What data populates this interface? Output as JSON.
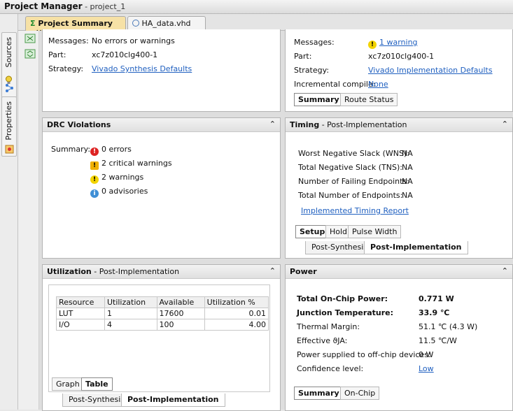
{
  "window": {
    "app": "Project Manager",
    "project": "project_1"
  },
  "sidebar": {
    "tabs": [
      {
        "label": "Sources",
        "icon": "hierarchy-icon"
      },
      {
        "label": "Properties",
        "icon": "properties-icon"
      }
    ]
  },
  "tabs": [
    {
      "label": "Project Summary",
      "close": "✕",
      "icon": "sigma-icon"
    },
    {
      "label": "HA_data.vhd",
      "close": "✕",
      "icon": "vhdl-file-icon"
    }
  ],
  "synthesis": {
    "messages_label": "Messages:",
    "messages_value": "No errors or warnings",
    "part_label": "Part:",
    "part_value": "xc7z010clg400-1",
    "strategy_label": "Strategy:",
    "strategy_value": "Vivado Synthesis Defaults"
  },
  "implementation": {
    "messages_label": "Messages:",
    "messages_value": "1 warning",
    "part_label": "Part:",
    "part_value": "xc7z010clg400-1",
    "strategy_label": "Strategy:",
    "strategy_value": "Vivado Implementation Defaults",
    "incremental_label": "Incremental compile:",
    "incremental_value": "None",
    "tabs": [
      "Summary",
      "Route Status"
    ]
  },
  "drc": {
    "title": "DRC Violations",
    "summary_label": "Summary:",
    "items": [
      "0 errors",
      "2 critical warnings",
      "2 warnings",
      "0 advisories"
    ]
  },
  "timing": {
    "title": "Timing",
    "subtitle": "- Post-Implementation",
    "rows": [
      {
        "label": "Worst Negative Slack (WNS):",
        "value": "NA"
      },
      {
        "label": "Total Negative Slack (TNS):",
        "value": "NA"
      },
      {
        "label": "Number of Failing Endpoints:",
        "value": "NA"
      },
      {
        "label": "Total Number of Endpoints:",
        "value": "NA"
      }
    ],
    "report_link": "Implemented Timing Report",
    "tabs": [
      "Setup",
      "Hold",
      "Pulse Width"
    ],
    "subtabs": [
      "Post-Synthesis",
      "Post-Implementation"
    ]
  },
  "utilization": {
    "title": "Utilization",
    "subtitle": "- Post-Implementation",
    "columns": [
      "Resource",
      "Utilization",
      "Available",
      "Utilization %"
    ],
    "rows": [
      [
        "LUT",
        "1",
        "17600",
        "0.01"
      ],
      [
        "I/O",
        "4",
        "100",
        "4.00"
      ]
    ],
    "tabs": [
      "Graph",
      "Table"
    ],
    "subtabs": [
      "Post-Synthesis",
      "Post-Implementation"
    ]
  },
  "power": {
    "title": "Power",
    "total_label": "Total On-Chip Power:",
    "total_value": "0.771 W",
    "junction_label": "Junction Temperature:",
    "junction_value": "33.9 ℃",
    "margin_label": "Thermal Margin:",
    "margin_value": "51.1 ℃ (4.3 W)",
    "theta_label": "Effective ϑJA:",
    "theta_value": "11.5 ℃/W",
    "offchip_label": "Power supplied to off-chip devices:",
    "offchip_value": "0 W",
    "confidence_label": "Confidence level:",
    "confidence_value": "Low",
    "tabs": [
      "Summary",
      "On-Chip"
    ]
  },
  "collapse_glyph": "⌃",
  "colors": {
    "active_tab": "#f6e1a6",
    "link": "#2060c0",
    "error": "#dd2222",
    "warning": "#f3d400",
    "info": "#3f8fd6"
  }
}
